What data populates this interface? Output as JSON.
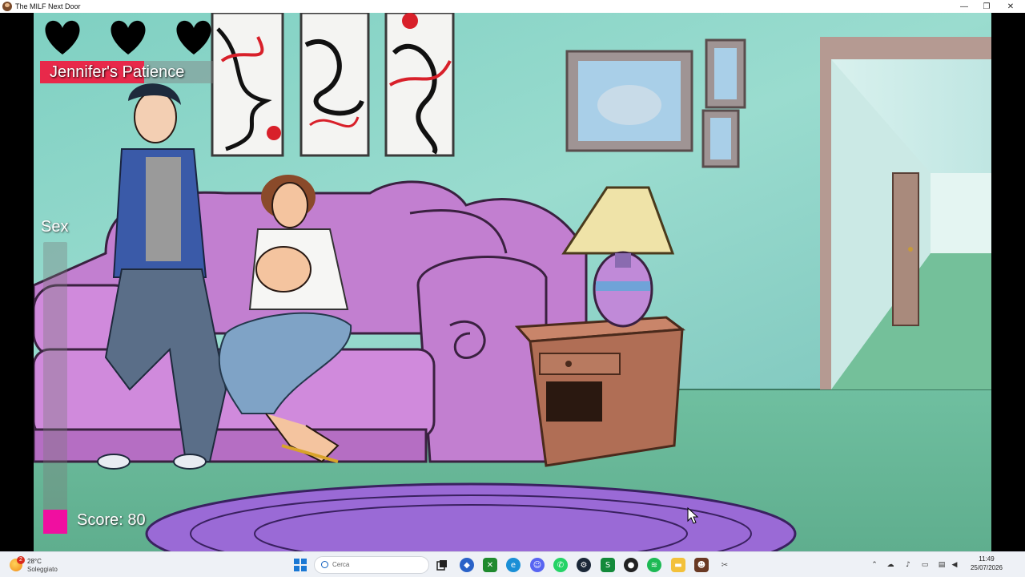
{
  "window": {
    "title": "The MILF Next Door",
    "controls": {
      "minimize": "—",
      "maximize": "❐",
      "close": "✕"
    }
  },
  "hud": {
    "hearts": [
      {
        "state": "full",
        "icon": "heart-icon"
      },
      {
        "state": "full",
        "icon": "heart-icon"
      },
      {
        "state": "full",
        "icon": "heart-icon"
      }
    ],
    "patience_label": "Jennifer's Patience",
    "patience_level": 0.6,
    "sex_label": "Sex",
    "sex_level": 0.0,
    "score_label": "Score: 80",
    "colors": {
      "patience": "#e8294a",
      "sex": "#ff1aa8",
      "heart": "#000000"
    }
  },
  "taskbar": {
    "weather": {
      "badge": "2",
      "temp": "28°C",
      "desc": "Soleggiato"
    },
    "search_placeholder": "Cerca",
    "apps": [
      {
        "name": "start-icon"
      },
      {
        "name": "task-view-icon"
      },
      {
        "name": "app-blue-icon"
      },
      {
        "name": "xbox-icon"
      },
      {
        "name": "edge-icon"
      },
      {
        "name": "discord-icon"
      },
      {
        "name": "whatsapp-icon"
      },
      {
        "name": "steam-icon"
      },
      {
        "name": "app-green-icon"
      },
      {
        "name": "app-dark-icon"
      },
      {
        "name": "spotify-icon"
      },
      {
        "name": "file-explorer-icon"
      },
      {
        "name": "game-icon"
      },
      {
        "name": "snipping-tool-icon"
      }
    ],
    "time": "11:49",
    "date": "25/07/2026"
  }
}
